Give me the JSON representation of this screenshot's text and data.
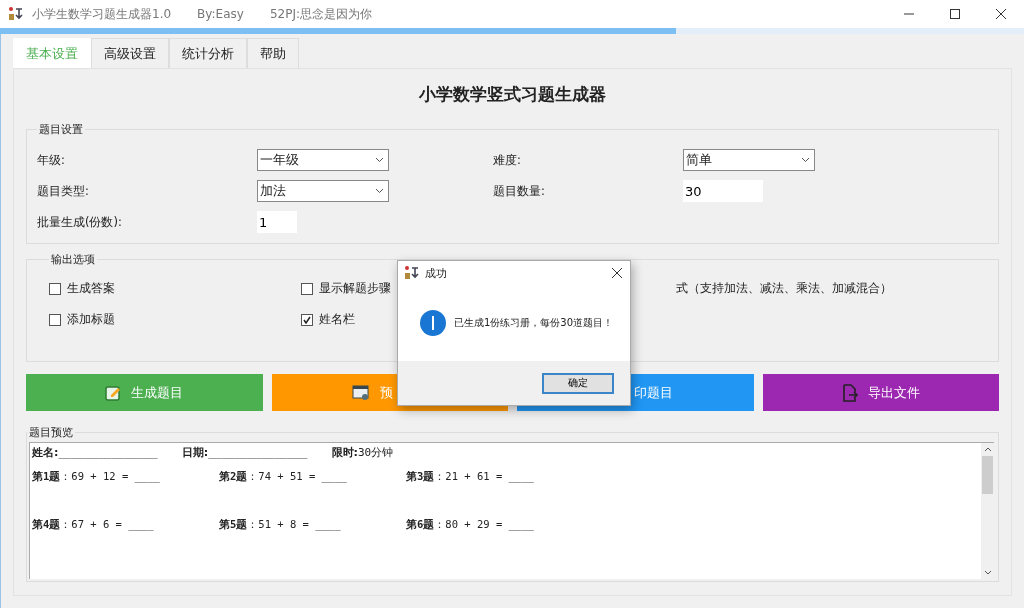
{
  "window": {
    "title": "小学生数学习题生成器1.0",
    "author": "By:Easy",
    "credit": "52PJ:思念是因为你"
  },
  "tabs": [
    {
      "label": "基本设置",
      "selected": true
    },
    {
      "label": "高级设置",
      "selected": false
    },
    {
      "label": "统计分析",
      "selected": false
    },
    {
      "label": "帮助",
      "selected": false
    }
  ],
  "heading": "小学数学竖式习题生成器",
  "settings": {
    "legend": "题目设置",
    "fields": [
      {
        "label": "年级:",
        "kind": "dropdown",
        "value": "一年级"
      },
      {
        "label": "难度:",
        "kind": "dropdown",
        "value": "简单"
      },
      {
        "label": "题目类型:",
        "kind": "dropdown",
        "value": "加法"
      },
      {
        "label": "题目数量:",
        "kind": "input",
        "value": "30"
      },
      {
        "label": "批量生成(份数):",
        "kind": "input",
        "value": "1"
      }
    ]
  },
  "output": {
    "legend": "输出选项",
    "options": [
      {
        "label": "生成答案",
        "checked": false
      },
      {
        "label": "显示解题步骤",
        "checked": false
      },
      {
        "label": "式（支持加法、减法、乘法、加减混合）"
      },
      {
        "label": "添加标题",
        "checked": false
      },
      {
        "label": "姓名栏",
        "checked": true
      }
    ]
  },
  "actions": [
    {
      "label": "生成题目",
      "kind": "edit",
      "color": "#4caf50"
    },
    {
      "label": "预",
      "kind": "preview",
      "color": "#ff9800"
    },
    {
      "label": "印题目",
      "kind": "covered",
      "color": "#2196f3"
    },
    {
      "label": "导出文件",
      "kind": "export",
      "color": "#9c27b0"
    }
  ],
  "preview": {
    "legend": "题目预览",
    "header": [
      {
        "label": "姓名:",
        "value": "_______________"
      },
      {
        "label": "日期:",
        "value": "_______________"
      },
      {
        "label": "限时:",
        "value": "30分钟"
      }
    ],
    "problems": [
      "**第1题**：69 + 12 = ____",
      "**第2题**：74 + 51 = ____",
      "**第3题**：21 + 61 = ____",
      "**第4题**：67 + 6 = ____",
      "**第5题**：51 + 8 = ____",
      "**第6题**：80 + 29 = ____"
    ]
  },
  "dialog": {
    "title": "成功",
    "message": "已生成1份练习册，每份30道题目！",
    "button": "确定"
  }
}
